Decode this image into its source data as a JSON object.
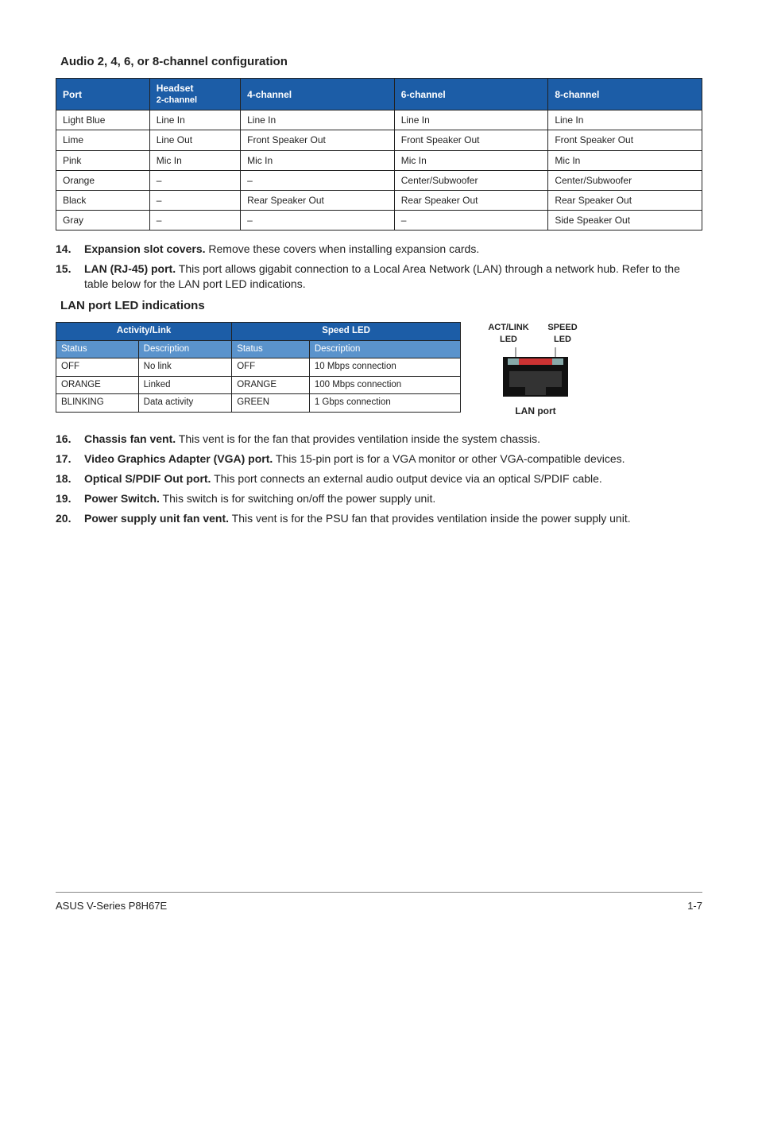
{
  "audio_title": "Audio 2, 4, 6, or 8-channel configuration",
  "audio_headers": {
    "port": "Port",
    "h2a": "Headset",
    "h2b": "2-channel",
    "h4": "4-channel",
    "h6": "6-channel",
    "h8": "8-channel"
  },
  "audio_rows": [
    {
      "port": "Light Blue",
      "c2": "Line In",
      "c4": "Line In",
      "c6": "Line In",
      "c8": "Line In"
    },
    {
      "port": "Lime",
      "c2": "Line Out",
      "c4": "Front Speaker Out",
      "c6": "Front Speaker Out",
      "c8": "Front Speaker Out"
    },
    {
      "port": "Pink",
      "c2": "Mic In",
      "c4": "Mic In",
      "c6": "Mic In",
      "c8": "Mic In"
    },
    {
      "port": "Orange",
      "c2": "–",
      "c4": "–",
      "c6": "Center/Subwoofer",
      "c8": "Center/Subwoofer"
    },
    {
      "port": "Black",
      "c2": "–",
      "c4": "Rear Speaker Out",
      "c6": "Rear Speaker Out",
      "c8": "Rear Speaker Out"
    },
    {
      "port": "Gray",
      "c2": "–",
      "c4": "–",
      "c6": "–",
      "c8": "Side Speaker Out"
    }
  ],
  "item14": {
    "num": "14.",
    "bold": "Expansion slot covers.",
    "rest": " Remove these covers when installing expansion cards."
  },
  "item15": {
    "num": "15.",
    "bold": "LAN (RJ-45) port.",
    "rest": " This port allows gigabit connection to a Local Area Network (LAN) through a network hub. Refer to the table below for the LAN port LED indications."
  },
  "lan_title": "LAN port LED indications",
  "lan_group1": "Activity/Link",
  "lan_group2": "Speed LED",
  "lan_headers": {
    "s1": "Status",
    "d1": "Description",
    "s2": "Status",
    "d2": "Description"
  },
  "lan_rows": [
    {
      "a": "OFF",
      "b": "No link",
      "c": "OFF",
      "d": "10 Mbps connection"
    },
    {
      "a": "ORANGE",
      "b": "Linked",
      "c": "ORANGE",
      "d": "100 Mbps connection"
    },
    {
      "a": "BLINKING",
      "b": "Data activity",
      "c": "GREEN",
      "d": "1 Gbps connection"
    }
  ],
  "diag": {
    "l1a": "ACT/LINK",
    "l1b": "LED",
    "l2a": "SPEED",
    "l2b": "LED",
    "caption": "LAN port"
  },
  "item16": {
    "num": "16.",
    "bold": "Chassis fan vent.",
    "rest": " This vent is for the fan that provides ventilation inside the system chassis."
  },
  "item17": {
    "num": "17.",
    "bold": "Video Graphics Adapter (VGA) port.",
    "rest": " This 15-pin port is for a VGA monitor or other VGA-compatible devices."
  },
  "item18": {
    "num": "18.",
    "bold": "Optical S/PDIF Out port.",
    "rest": " This port connects an external audio output device via an optical S/PDIF cable."
  },
  "item19": {
    "num": "19.",
    "bold": "Power Switch.",
    "rest": " This switch is for switching on/off the power supply unit."
  },
  "item20": {
    "num": "20.",
    "bold": "Power supply unit fan vent.",
    "rest": " This vent is for the PSU fan that provides ventilation inside the power supply unit."
  },
  "footer": {
    "left": "ASUS V-Series P8H67E",
    "right": "1-7"
  }
}
